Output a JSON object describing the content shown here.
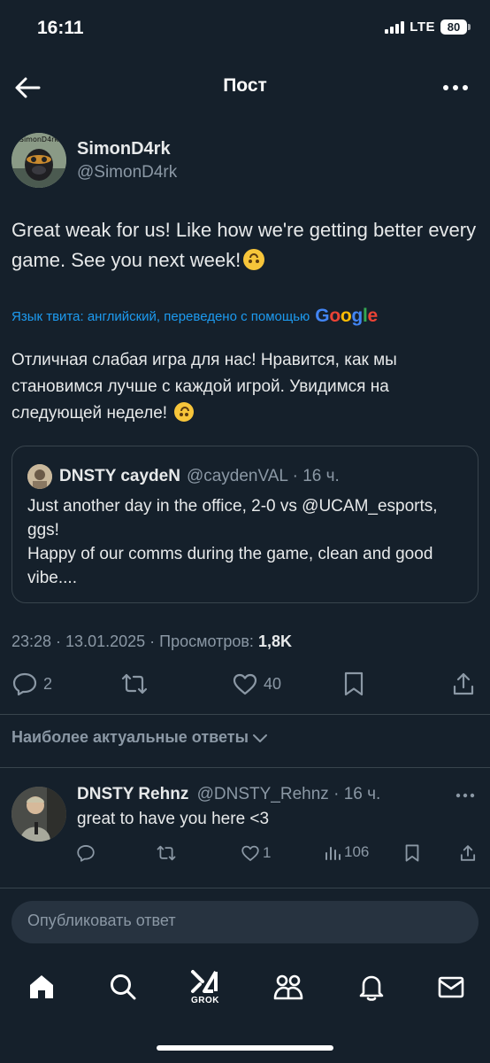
{
  "status_bar": {
    "time": "16:11",
    "network": "LTE",
    "battery": "80"
  },
  "header": {
    "title": "Пост"
  },
  "post": {
    "author_name": "SimonD4rk",
    "author_handle": "@SimonD4rk",
    "avatar_text": "SimonD4rk",
    "text": "Great weak for us! Like how we're getting better every game. See you next week!",
    "translation_label": "Язык твита: английский, переведено с помощью",
    "translation_provider": "Google",
    "translated_text": "Отличная слабая игра для нас! Нравится, как мы становимся лучше с каждой игрой. Увидимся на следующей неделе!",
    "time": "23:28",
    "date": "13.01.2025",
    "views_label": "Просмотров:",
    "views": "1,8K",
    "replies": "2",
    "likes": "40"
  },
  "quote": {
    "author_name": "DNSTY caydeN",
    "author_handle": "@caydenVAL",
    "age": "16 ч.",
    "text": "Just another day in the office, 2-0 vs @UCAM_esports, ggs!\nHappy of our comms during the game, clean and good vibe...."
  },
  "sort": {
    "label": "Наиболее актуальные ответы"
  },
  "reply": {
    "author_name": "DNSTY Rehnz",
    "author_handle": "@DNSTY_Rehnz",
    "age": "16 ч.",
    "text": "great to have you here <3",
    "likes": "1",
    "views": "106"
  },
  "compose": {
    "placeholder": "Опубликовать ответ"
  },
  "tabbar": {
    "grok_label": "GROK"
  },
  "colors": {
    "background": "#15202b",
    "accent": "#1d9bf0",
    "muted": "#8b98a5",
    "text": "#e7e9ea"
  }
}
